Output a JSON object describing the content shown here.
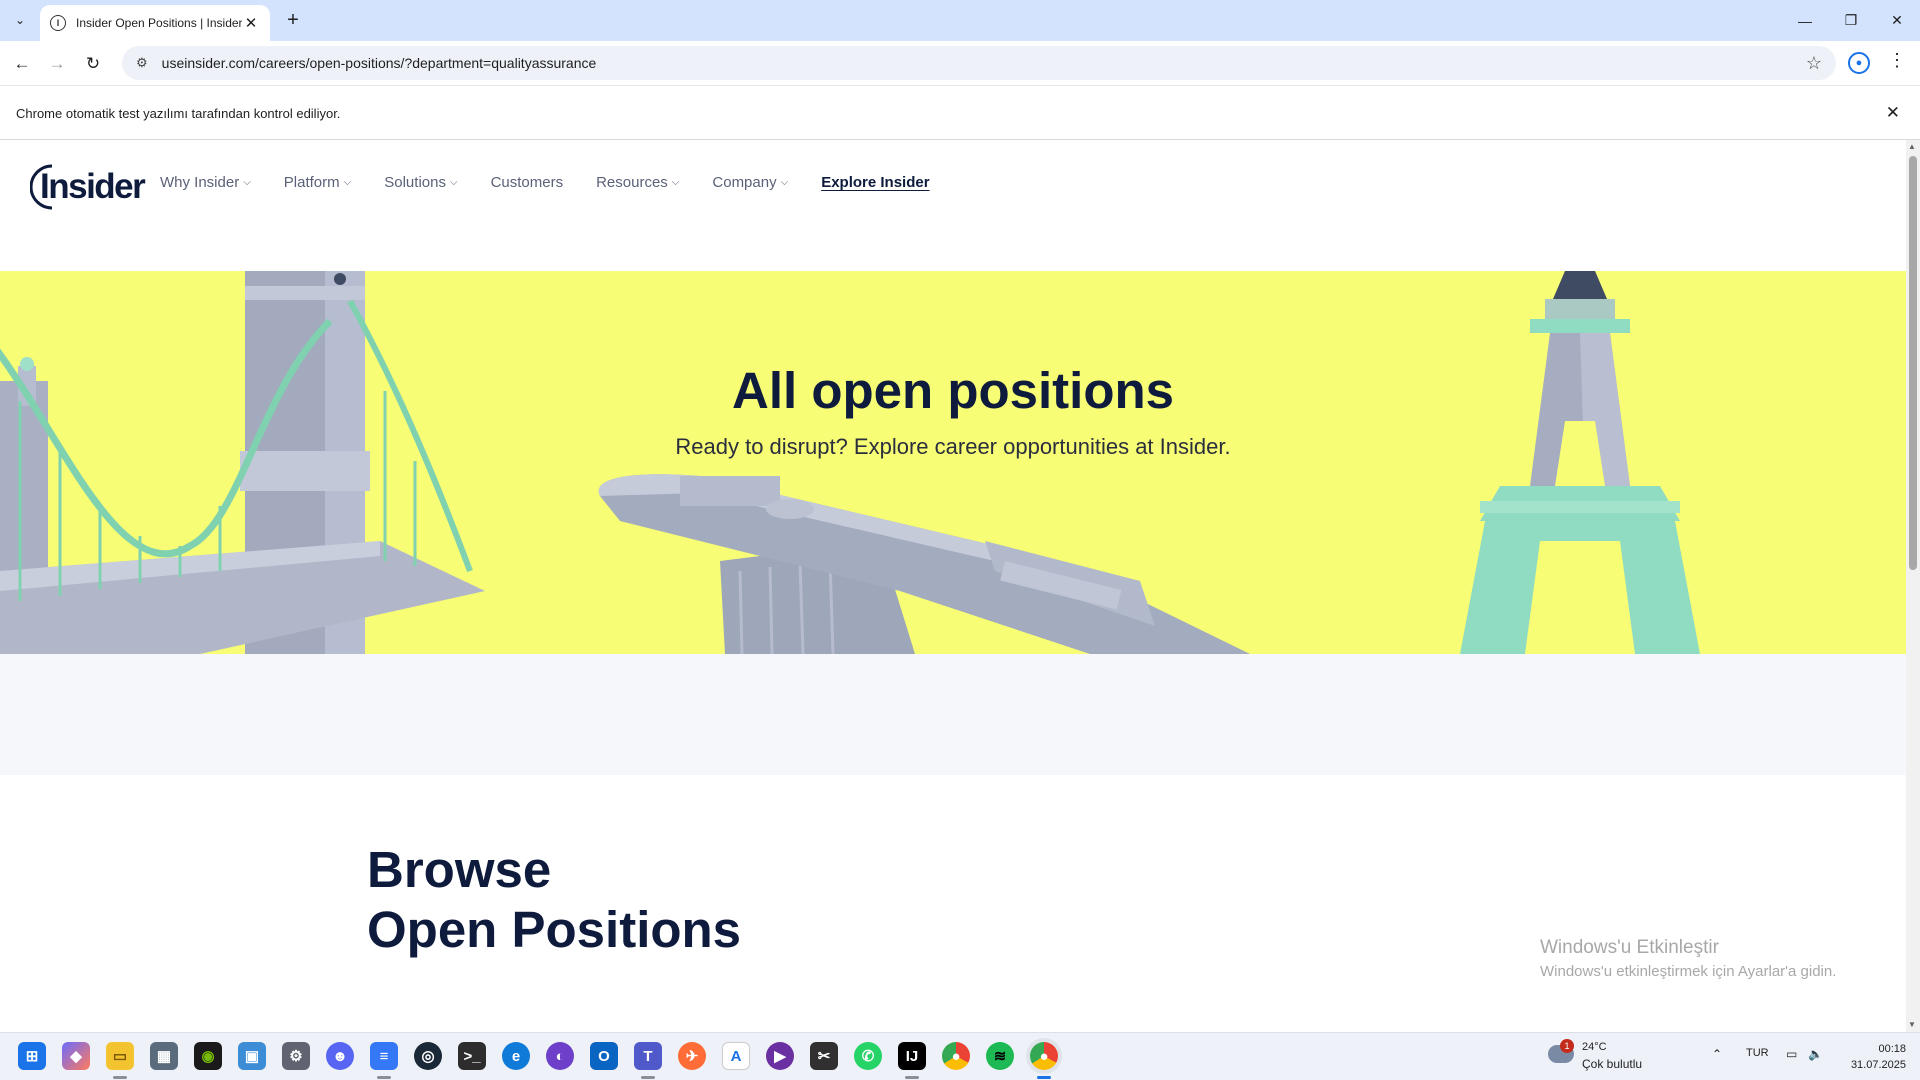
{
  "browser": {
    "tab_title": "Insider Open Positions | Insider",
    "url": "useinsider.com/careers/open-positions/?department=qualityassurance",
    "automation_notice": "Chrome otomatik test yazılımı tarafından kontrol ediliyor."
  },
  "site": {
    "logo_text": "Insider",
    "nav": [
      {
        "label": "Why Insider",
        "has_dropdown": true
      },
      {
        "label": "Platform",
        "has_dropdown": true
      },
      {
        "label": "Solutions",
        "has_dropdown": true
      },
      {
        "label": "Customers",
        "has_dropdown": false
      },
      {
        "label": "Resources",
        "has_dropdown": true
      },
      {
        "label": "Company",
        "has_dropdown": true
      },
      {
        "label": "Explore Insider",
        "has_dropdown": false
      }
    ]
  },
  "hero": {
    "title": "All open positions",
    "subtitle": "Ready to disrupt? Explore career opportunities at Insider.",
    "background_color": "#f7fd74"
  },
  "browse": {
    "line1": "Browse",
    "line2": "Open Positions"
  },
  "watermark": {
    "title": "Windows'u Etkinleştir",
    "subtitle": "Windows'u etkinleştirmek için Ayarlar'a gidin."
  },
  "taskbar": {
    "weather_temp": "24°C",
    "weather_condition": "Çok bulutlu",
    "weather_badge": "1",
    "language": "TUR",
    "time": "00:18",
    "date": "31.07.2025"
  }
}
